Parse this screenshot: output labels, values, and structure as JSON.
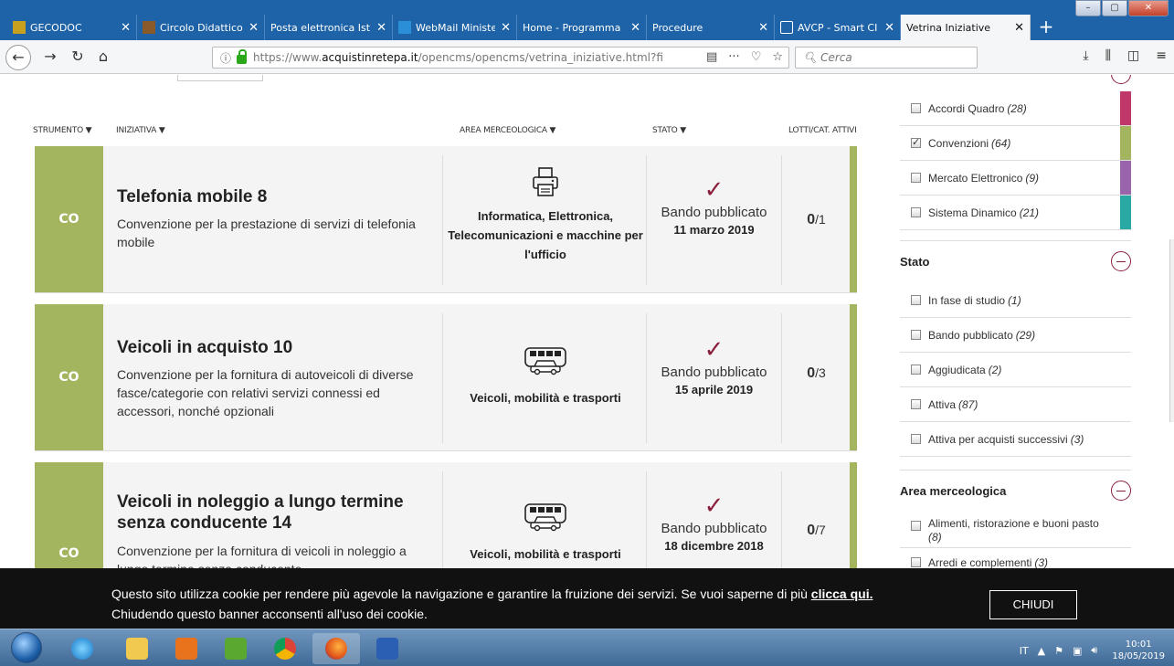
{
  "browser": {
    "tabs": [
      {
        "label": "GECODOC",
        "icon": "gecodoc-icon",
        "color": "#c8a020"
      },
      {
        "label": "Circolo Didattico",
        "icon": "school-icon",
        "color": "#8b5a2b"
      },
      {
        "label": "Posta elettronica Istr",
        "icon": "mail-icon",
        "color": "#ffffff"
      },
      {
        "label": "WebMail Minister",
        "icon": "webmail-icon",
        "color": "#2a8fd6"
      },
      {
        "label": "Home - Programma",
        "icon": "page-icon",
        "color": "#ffffff"
      },
      {
        "label": "Procedure",
        "icon": "page-icon",
        "color": "#ffffff"
      },
      {
        "label": "AVCP - Smart CI",
        "icon": "avcp-icon",
        "color": "#ffffff"
      },
      {
        "label": "Vetrina Iniziative",
        "icon": "page-icon",
        "color": "#ffffff"
      }
    ],
    "url_prefix": "https://www.",
    "url_domain": "acquistinretepa.it",
    "url_rest": "/opencms/opencms/vetrina_iniziative.html?fil",
    "search_placeholder": "Cerca"
  },
  "table": {
    "headers": {
      "strumento": "STRUMENTO ▼",
      "iniziativa": "INIZIATIVA ▼",
      "area": "AREA MERCEOLOGICA ▼",
      "stato": "STATO ▼",
      "lotti": "LOTTI/CAT. ATTIVI"
    },
    "rows": [
      {
        "tag": "CO",
        "title": "Telefonia mobile 8",
        "desc": "Convenzione per la prestazione di servizi di telefonia mobile",
        "area_icon": "printer-icon",
        "area": "Informatica, Elettronica, Telecomunicazioni e macchine per l'ufficio",
        "stato": "Bando pubblicato",
        "date": "11 marzo 2019",
        "lotti_active": "0",
        "lotti_total": "/1"
      },
      {
        "tag": "CO",
        "title": "Veicoli in acquisto 10",
        "desc": "Convenzione per la fornitura di autoveicoli di diverse fasce/categorie con relativi servizi connessi ed accessori, nonché opzionali",
        "area_icon": "vehicles-icon",
        "area": "Veicoli, mobilità e trasporti",
        "stato": "Bando pubblicato",
        "date": "15 aprile 2019",
        "lotti_active": "0",
        "lotti_total": "/3"
      },
      {
        "tag": "CO",
        "title": "Veicoli in noleggio a lungo termine senza conducente 14",
        "desc": "Convenzione per la fornitura di veicoli in noleggio a lungo termine senza conducente",
        "area_icon": "vehicles-icon",
        "area": "Veicoli, mobilità e trasporti",
        "stato": "Bando pubblicato",
        "date": "18 dicembre 2018",
        "lotti_active": "0",
        "lotti_total": "/7"
      }
    ]
  },
  "filters": {
    "strumento": [
      {
        "label": "Accordi Quadro",
        "count": "(28)",
        "checked": false,
        "color": "#c0376a"
      },
      {
        "label": "Convenzioni",
        "count": "(64)",
        "checked": true,
        "color": "#a4b560"
      },
      {
        "label": "Mercato Elettronico",
        "count": "(9)",
        "checked": false,
        "color": "#9a64ad"
      },
      {
        "label": "Sistema Dinamico",
        "count": "(21)",
        "checked": false,
        "color": "#2aa8a4"
      }
    ],
    "stato_title": "Stato",
    "stato": [
      {
        "label": "In fase di studio",
        "count": "(1)"
      },
      {
        "label": "Bando pubblicato",
        "count": "(29)"
      },
      {
        "label": "Aggiudicata",
        "count": "(2)"
      },
      {
        "label": "Attiva",
        "count": "(87)"
      },
      {
        "label": "Attiva per acquisti successivi",
        "count": "(3)"
      }
    ],
    "area_title": "Area merceologica",
    "area": [
      {
        "label": "Alimenti, ristorazione e buoni pasto",
        "count": "(8)"
      },
      {
        "label": "Arredi e complementi",
        "count": "(3)"
      }
    ]
  },
  "cookie": {
    "text": "Questo sito utilizza cookie per rendere più agevole la navigazione e garantire la fruizione dei servizi. Se vuoi saperne di più ",
    "link": "clicca qui.",
    "text2": "Chiudendo questo banner acconsenti all'uso dei cookie.",
    "button": "CHIUDI"
  },
  "taskbar": {
    "lang": "IT",
    "time": "10:01",
    "date": "18/05/2019"
  }
}
